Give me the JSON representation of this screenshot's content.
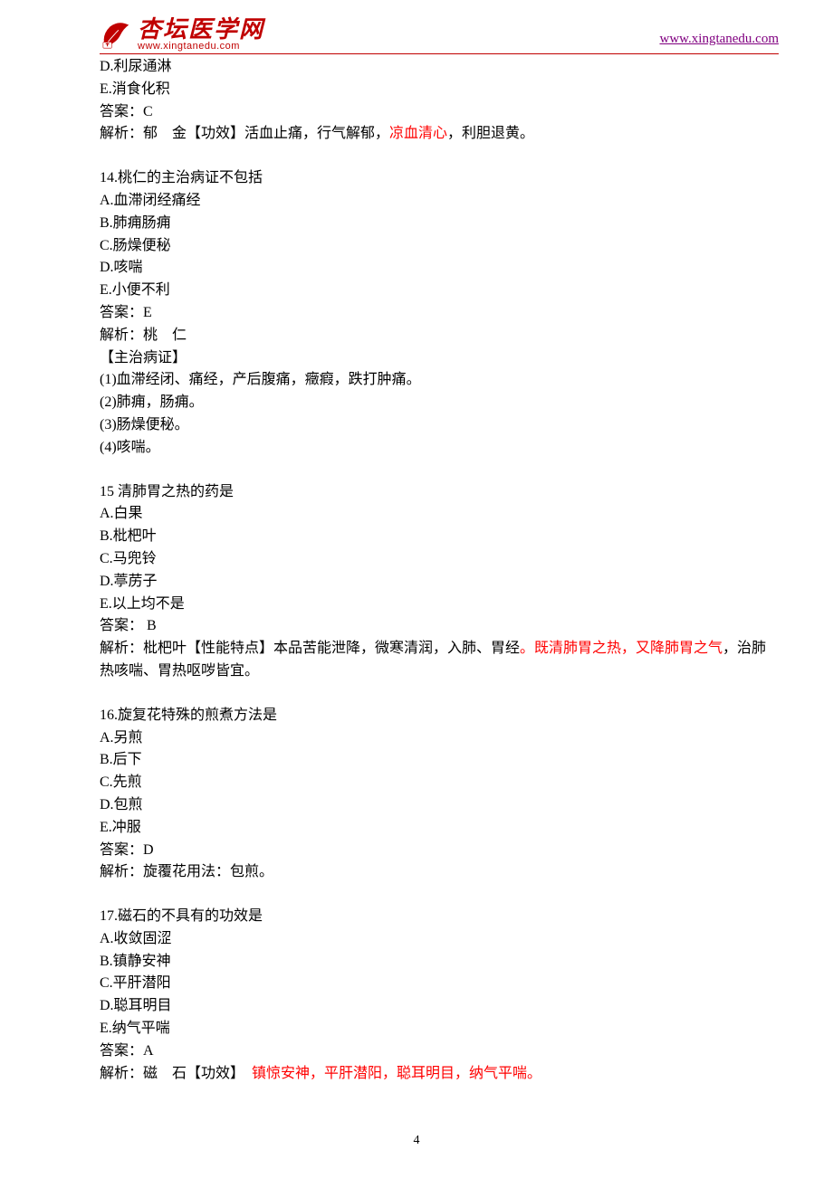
{
  "header": {
    "logo_cn": "杏坛医学网",
    "logo_url": "www.xingtanedu.com",
    "link": "www.xingtanedu.com"
  },
  "q13_tail": {
    "optD": "D.利尿通淋",
    "optE": "E.消食化积",
    "answer": "答案：C",
    "expl_pre": "解析：郁　金【功效】活血止痛，行气解郁，",
    "expl_red": "凉血清心",
    "expl_post": "，利胆退黄。"
  },
  "q14": {
    "stem": "14.桃仁的主治病证不包括",
    "A": "A.血滞闭经痛经",
    "B": "B.肺痈肠痈",
    "C": "C.肠燥便秘",
    "D": "D.咳喘",
    "E": "E.小便不利",
    "answer": "答案：E",
    "expl1": "解析：桃　仁",
    "expl2": "【主治病证】",
    "expl3": "(1)血滞经闭、痛经，产后腹痛，癥瘕，跌打肿痛。",
    "expl4": "(2)肺痈，肠痈。",
    "expl5": "(3)肠燥便秘。",
    "expl6": "(4)咳喘。"
  },
  "q15": {
    "stem": "15 清肺胃之热的药是",
    "A": "A.白果",
    "B": "B.枇杷叶",
    "C": "C.马兜铃",
    "D": "D.葶苈子",
    "E": "E.以上均不是",
    "answer": "答案： B",
    "expl_pre": "解析：枇杷叶【性能特点】本品苦能泄降，微寒清润，入肺、胃经",
    "expl_red": "。既清肺胃之热，又降肺胃之气",
    "expl_post": "，治肺热咳喘、胃热呕哕皆宜。"
  },
  "q16": {
    "stem": "16.旋复花特殊的煎煮方法是",
    "A": "A.另煎",
    "B": "B.后下",
    "C": "C.先煎",
    "D": "D.包煎",
    "E": "E.冲服",
    "answer": "答案：D",
    "expl": "解析：旋覆花用法：包煎。"
  },
  "q17": {
    "stem": "17.磁石的不具有的功效是",
    "A": "A.收敛固涩",
    "B": "B.镇静安神",
    "C": "C.平肝潜阳",
    "D": "D.聪耳明目",
    "E": "E.纳气平喘",
    "answer": "答案：A",
    "expl_pre": "解析：磁　石【功效】　",
    "expl_red": "镇惊安神，平肝潜阳，聪耳明目，纳气平喘。"
  },
  "page_number": "4"
}
